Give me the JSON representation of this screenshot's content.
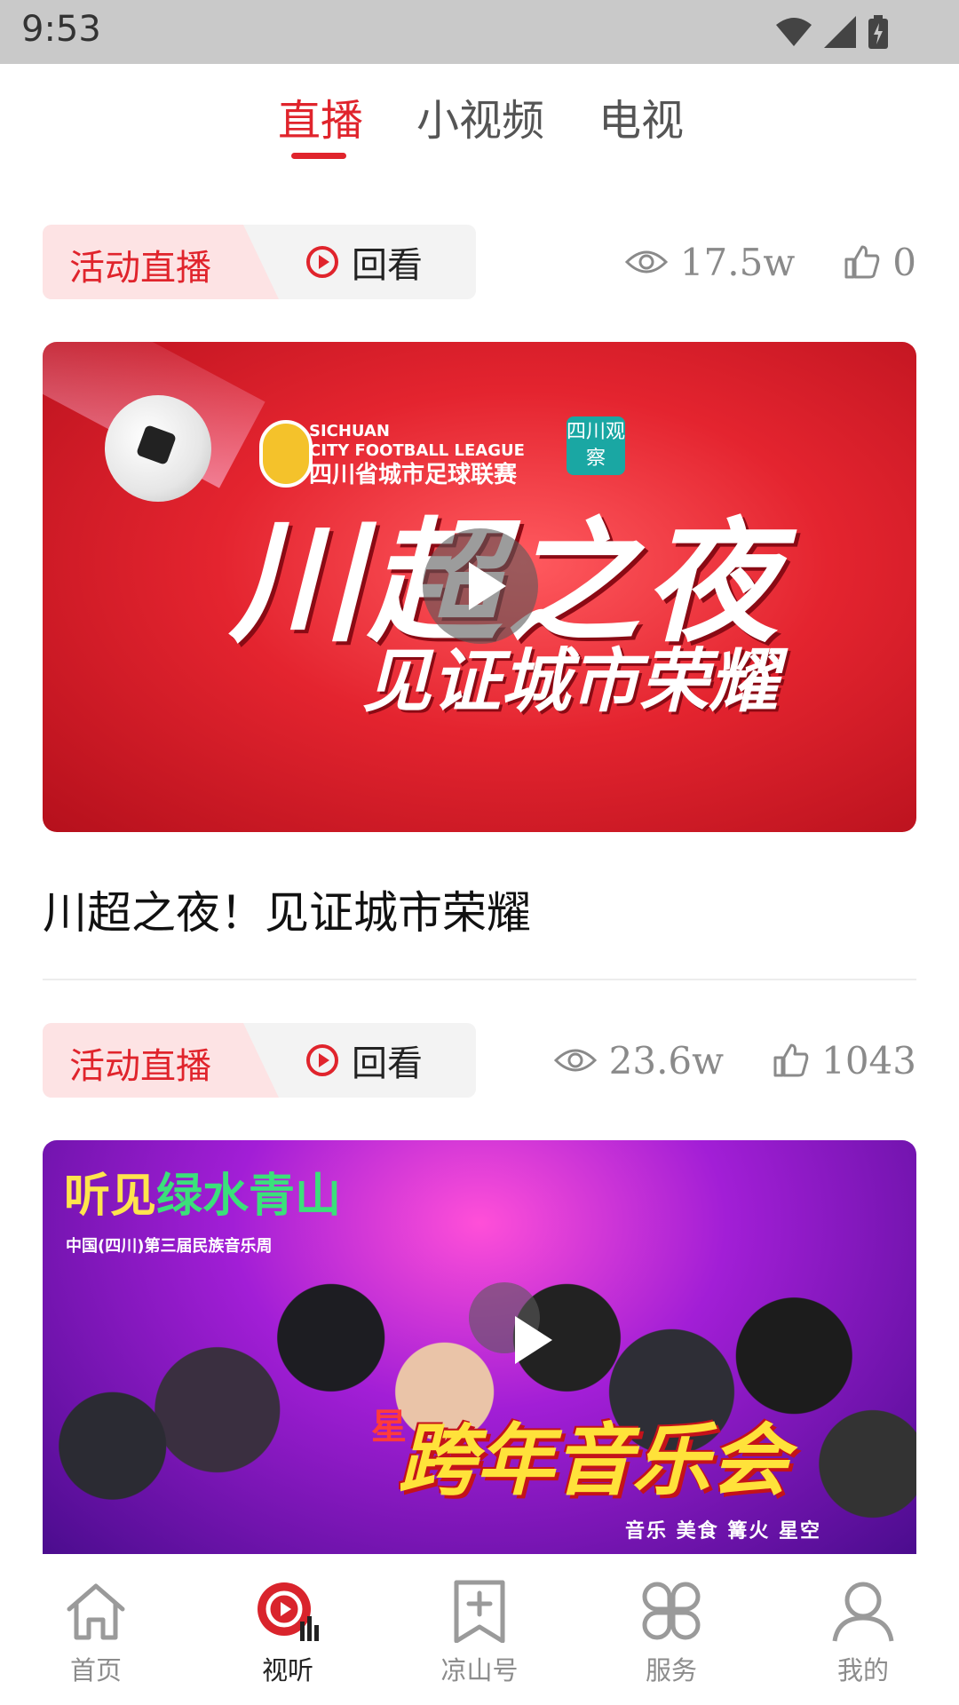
{
  "status_bar": {
    "time": "9:53"
  },
  "top_tabs": [
    {
      "label": "直播",
      "active": true
    },
    {
      "label": "小视频",
      "active": false
    },
    {
      "label": "电视",
      "active": false
    }
  ],
  "accent_color": "#e0242c",
  "items": [
    {
      "tag": "活动直播",
      "replay_label": "回看",
      "views": "17.5w",
      "likes": "0",
      "title": "川超之夜！见证城市荣耀",
      "banner": {
        "league_en_1": "SICHUAN",
        "league_en_2": "CITY FOOTBALL LEAGUE",
        "league_cn": "四川省城市足球联赛",
        "badge": "四川观察",
        "headline": "川超之夜",
        "subline": "见证城市荣耀"
      }
    },
    {
      "tag": "活动直播",
      "replay_label": "回看",
      "views": "23.6w",
      "likes": "1043",
      "banner": {
        "brand_1": "听见",
        "brand_2": "绿水青山",
        "subtitle": "中国(四川)第三届民族音乐周",
        "star": "星",
        "headline": "跨年音乐会",
        "tags": "音乐 美食 篝火 星空"
      }
    }
  ],
  "bottom_nav": [
    {
      "label": "首页",
      "icon": "home-icon",
      "active": false
    },
    {
      "label": "视听",
      "icon": "play-audio-icon",
      "active": true
    },
    {
      "label": "凉山号",
      "icon": "add-bookmark-icon",
      "active": false
    },
    {
      "label": "服务",
      "icon": "services-grid-icon",
      "active": false
    },
    {
      "label": "我的",
      "icon": "user-icon",
      "active": false
    }
  ]
}
